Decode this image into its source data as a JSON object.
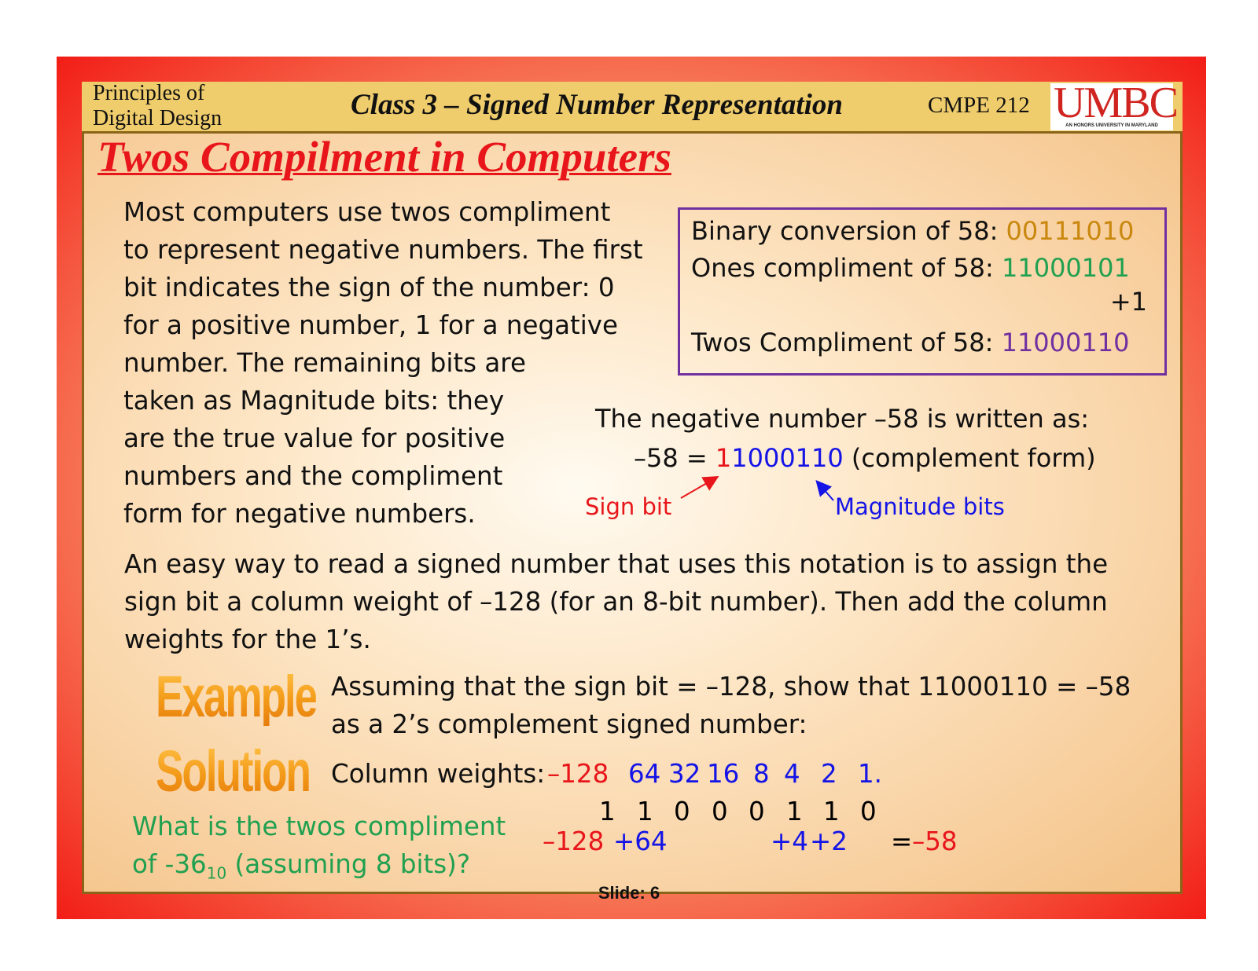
{
  "header": {
    "course_line1": "Principles of",
    "course_line2": "Digital Design",
    "class_title": "Class 3 – Signed Number Representation",
    "course_code": "CMPE 212",
    "logo": "UMBC",
    "logo_tagline": "AN HONORS UNIVERSITY IN MARYLAND"
  },
  "slide": {
    "heading": "Twos Compilment in Computers",
    "intro_lines": [
      "Most computers use twos compliment",
      "to represent negative numbers.  The first",
      "bit indicates the sign of the number: 0",
      "for a positive number, 1 for a negative",
      "number.  The remaining bits are",
      "taken as Magnitude bits: they",
      "are the true value for positive",
      "numbers and the compliment",
      "form for negative numbers."
    ],
    "conversion_box": {
      "binary_label": "Binary conversion of 58: ",
      "binary_value": "00111010",
      "ones_label": "Ones compliment of 58: ",
      "ones_value": "11000101",
      "plus_one": "+1",
      "twos_label": "Twos Compliment of 58: ",
      "twos_value": "11000110"
    },
    "negative": {
      "intro": "The negative number –58 is written as:",
      "eq_prefix": "–58 = ",
      "sign_digit": "1",
      "magnitude_digits": "1000110",
      "suffix": " (complement form)",
      "sign_label": "Sign bit",
      "magnitude_label": "Magnitude bits"
    },
    "easy_lines": [
      "An easy way to read a signed number that uses this notation is to assign the",
      "sign bit a column weight of –128 (for an 8-bit number). Then add the column",
      "weights for the 1’s."
    ],
    "example_art": "Example",
    "solution_art": "Solution",
    "example_lines": [
      "Assuming that the sign bit = –128, show that 11000110 = –58",
      "as a 2’s complement signed number:"
    ],
    "weights_label": "Column weights: ",
    "weights": [
      "–128",
      "64",
      "32",
      "16",
      "8",
      "4",
      "2",
      "1."
    ],
    "bits": [
      "1",
      "1",
      "0",
      "0",
      "0",
      "1",
      "1",
      "0"
    ],
    "sum_terms": [
      "–128",
      "+64",
      "+4",
      "+2"
    ],
    "sum_eq": "= ",
    "sum_result": "–58",
    "question_line1": "What is the twos compliment",
    "question_line2_prefix": "of -36",
    "question_sub": "10",
    "question_line2_suffix": " (assuming 8 bits)?",
    "footer": "Slide: 6"
  },
  "colors": {
    "heading_red": "#e8161b",
    "blue": "#1414e6",
    "green": "#20a050",
    "orange": "#c9870e",
    "purple": "#7030a0"
  }
}
